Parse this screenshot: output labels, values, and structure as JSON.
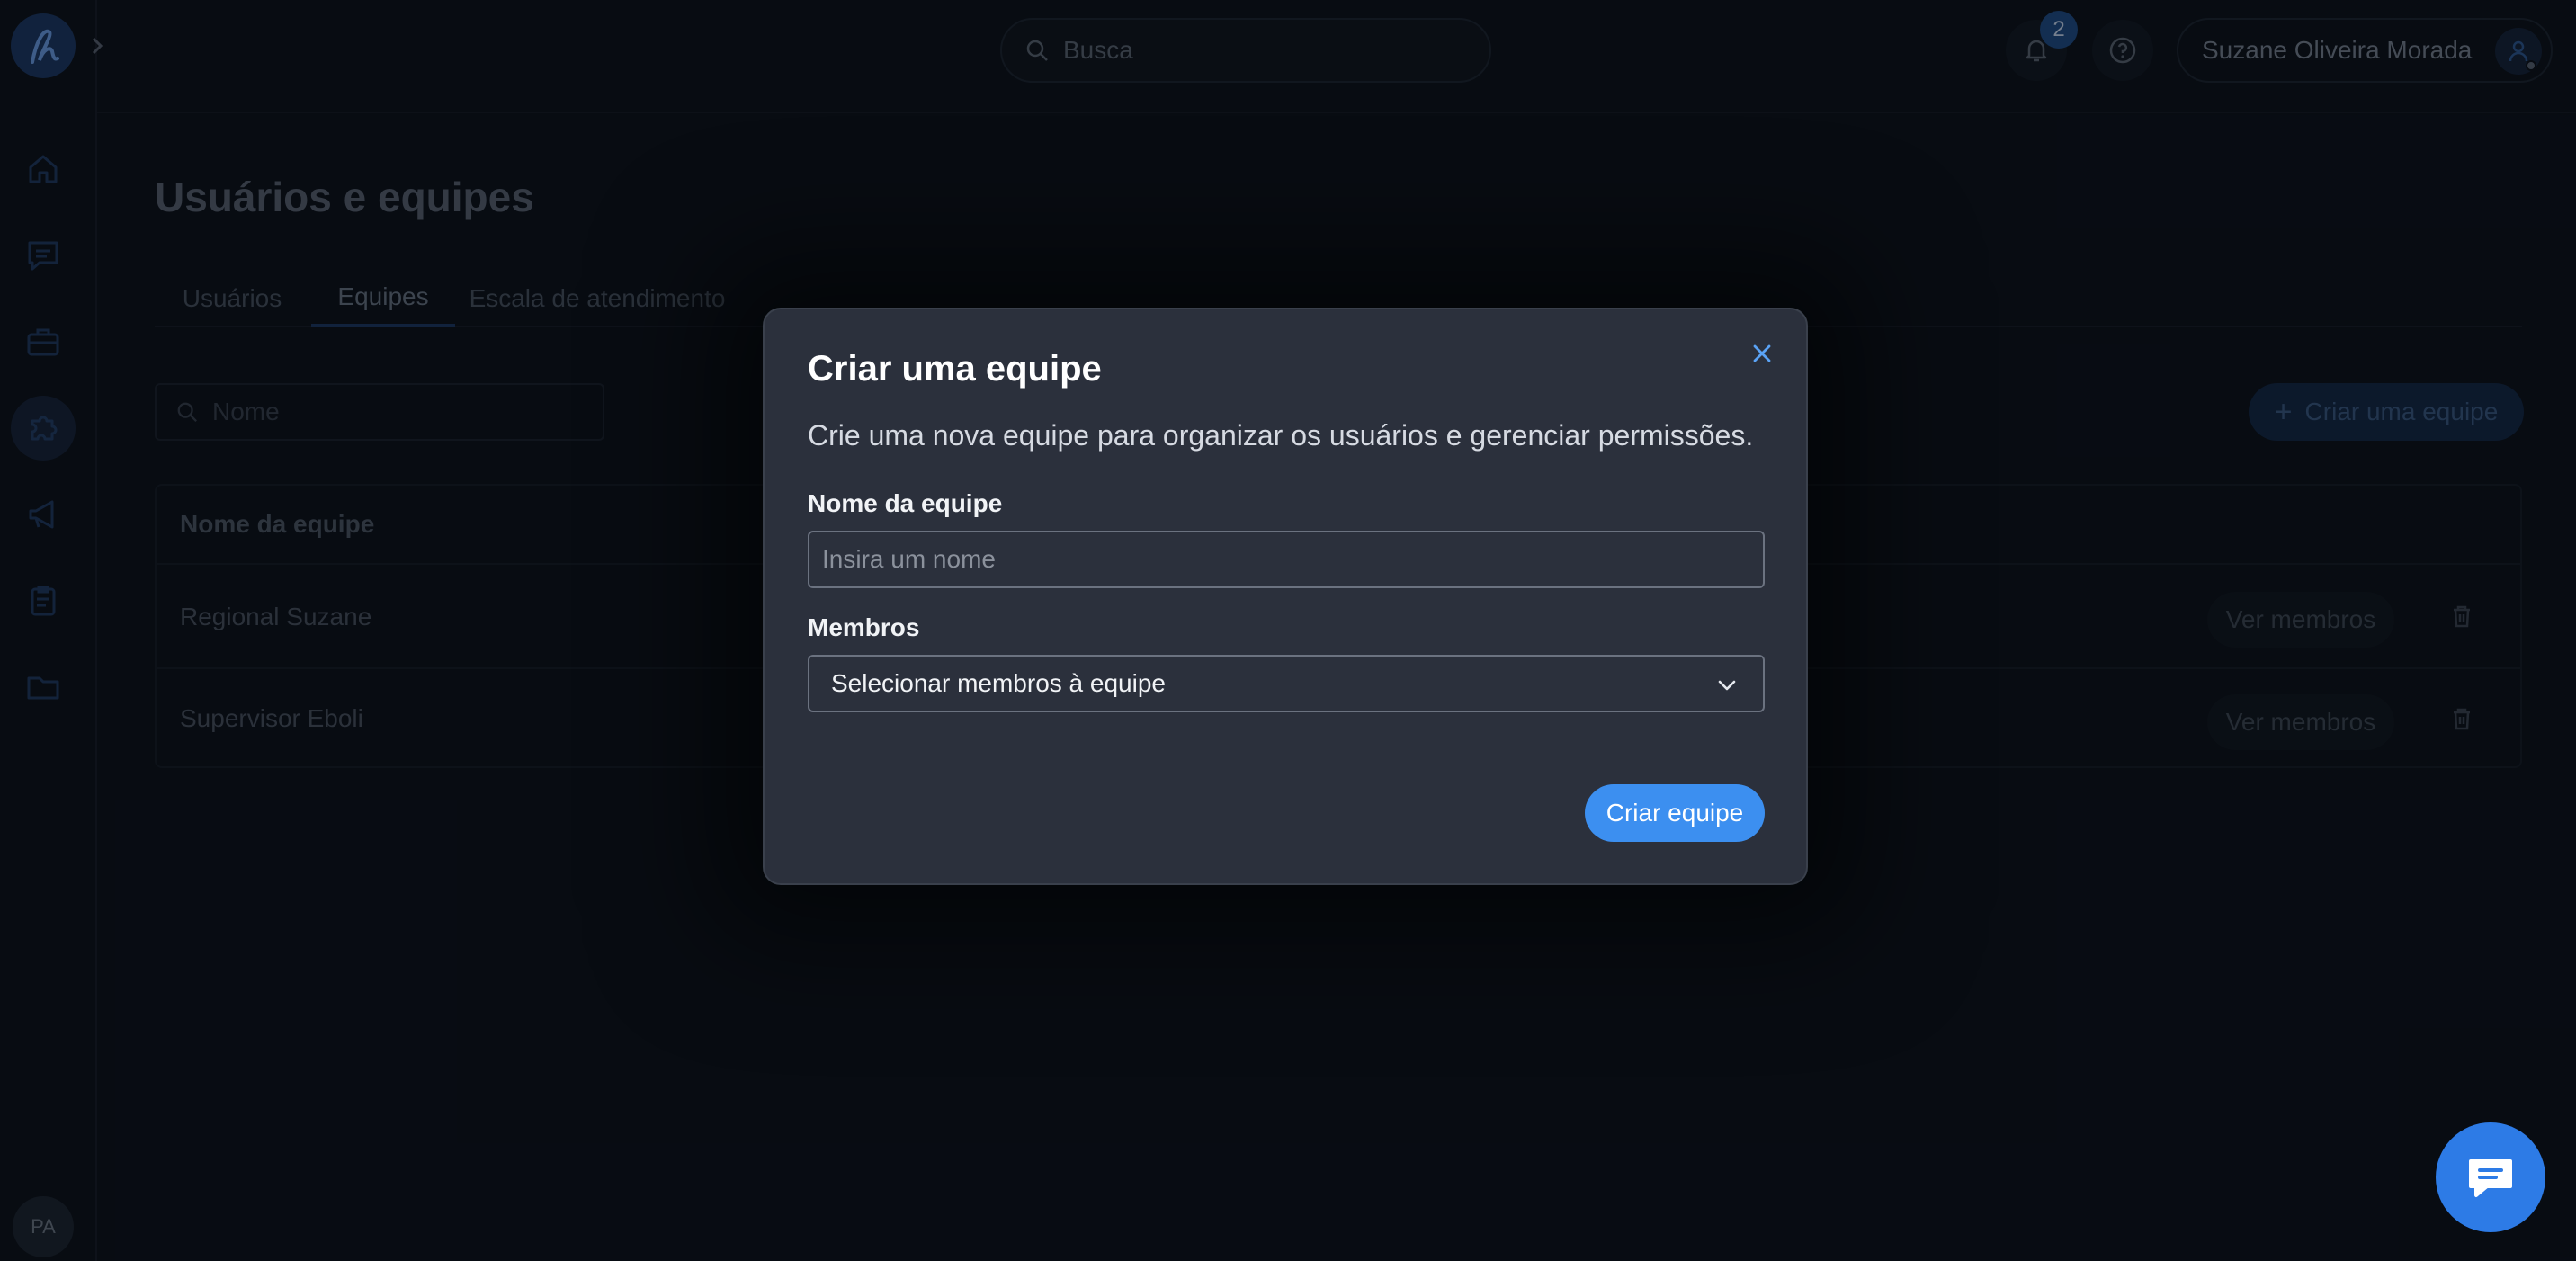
{
  "colors": {
    "accent": "#3c8ff0",
    "modal_bg": "#2b303c",
    "page_bg": "#0b1119"
  },
  "sidebar": {
    "logo_icon": "brand-logo-icon",
    "expand_icon": "chevron-right-icon",
    "items": [
      {
        "icon": "home-icon"
      },
      {
        "icon": "chat-icon"
      },
      {
        "icon": "briefcase-icon"
      },
      {
        "icon": "puzzle-icon",
        "active": true
      },
      {
        "icon": "megaphone-icon"
      },
      {
        "icon": "clipboard-icon"
      },
      {
        "icon": "folder-icon"
      }
    ],
    "user_initials": "PA"
  },
  "header": {
    "search_placeholder": "Busca",
    "notifications_count": "2",
    "user_name": "Suzane Oliveira Morada"
  },
  "page": {
    "title": "Usuários e equipes",
    "tabs": [
      {
        "label": "Usuários"
      },
      {
        "label": "Equipes",
        "active": true
      },
      {
        "label": "Escala de atendimento"
      }
    ],
    "filter_placeholder": "Nome",
    "create_button": "Criar uma equipe",
    "table": {
      "header": "Nome da equipe",
      "rows": [
        {
          "name": "Regional Suzane",
          "action": "Ver membros"
        },
        {
          "name": "Supervisor Eboli",
          "action": "Ver membros"
        }
      ]
    }
  },
  "modal": {
    "title": "Criar uma equipe",
    "description": "Crie uma nova equipe para organizar os usuários e gerenciar permissões.",
    "name_label": "Nome da equipe",
    "name_placeholder": "Insira um nome",
    "members_label": "Membros",
    "members_select": "Selecionar membros à equipe",
    "submit": "Criar equipe"
  }
}
